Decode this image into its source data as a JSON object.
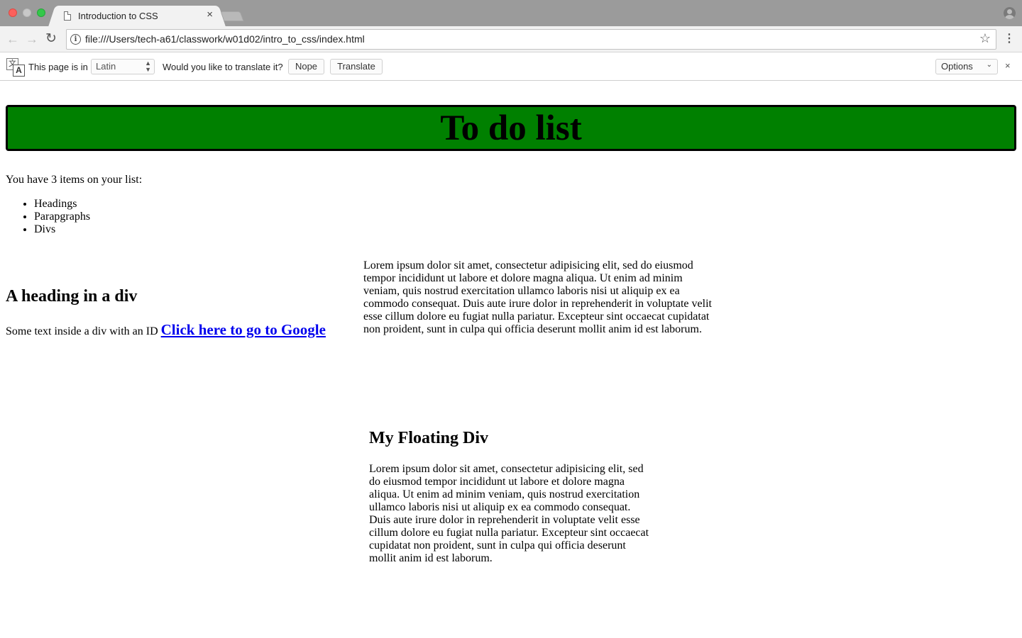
{
  "browser": {
    "tab_title": "Introduction to CSS",
    "tab_close": "×",
    "url": "file:///Users/tech-a61/classwork/w01d02/intro_to_css/index.html"
  },
  "translate_bar": {
    "page_is_in": "This page is in",
    "language": "Latin",
    "question": "Would you like to translate it?",
    "nope_label": "Nope",
    "translate_label": "Translate",
    "options_label": "Options",
    "close": "×"
  },
  "page": {
    "banner_title": "To do list",
    "intro": "You have 3 items on your list:",
    "items": [
      "Headings",
      "Parapgraphs",
      "Divs"
    ],
    "div_heading": "A heading in a div",
    "div_text": "Some text inside a div with an ID",
    "link_text": "Click here to go to Google",
    "lorem_paragraph": "Lorem ipsum dolor sit amet, consectetur adipisicing elit, sed do eiusmod tempor incididunt ut labore et dolore magna aliqua. Ut enim ad minim veniam, quis nostrud exercitation ullamco laboris nisi ut aliquip ex ea commodo consequat. Duis aute irure dolor in reprehenderit in voluptate velit esse cillum dolore eu fugiat nulla pariatur. Excepteur sint occaecat cupidatat non proident, sunt in culpa qui officia deserunt mollit anim id est laborum.",
    "floating_heading": "My Floating Div",
    "floating_paragraph": "Lorem ipsum dolor sit amet, consectetur adipisicing elit, sed do eiusmod tempor incididunt ut labore et dolore magna aliqua. Ut enim ad minim veniam, quis nostrud exercitation ullamco laboris nisi ut aliquip ex ea commodo consequat. Duis aute irure dolor in reprehenderit in voluptate velit esse cillum dolore eu fugiat nulla pariatur. Excepteur sint occaecat cupidatat non proident, sunt in culpa qui officia deserunt mollit anim id est laborum."
  },
  "colors": {
    "banner_background": "#008000",
    "link": "#0000ee",
    "close_red": "#fc605c",
    "maximize_green": "#34c84a"
  },
  "icons": [
    "close-window-icon",
    "minimize-window-icon",
    "maximize-window-icon",
    "page-icon",
    "close-tab-icon",
    "profile-icon",
    "back-arrow-icon",
    "forward-arrow-icon",
    "reload-icon",
    "info-icon",
    "star-icon",
    "menu-icon",
    "translate-icon",
    "chevron-down-icon",
    "close-icon"
  ]
}
